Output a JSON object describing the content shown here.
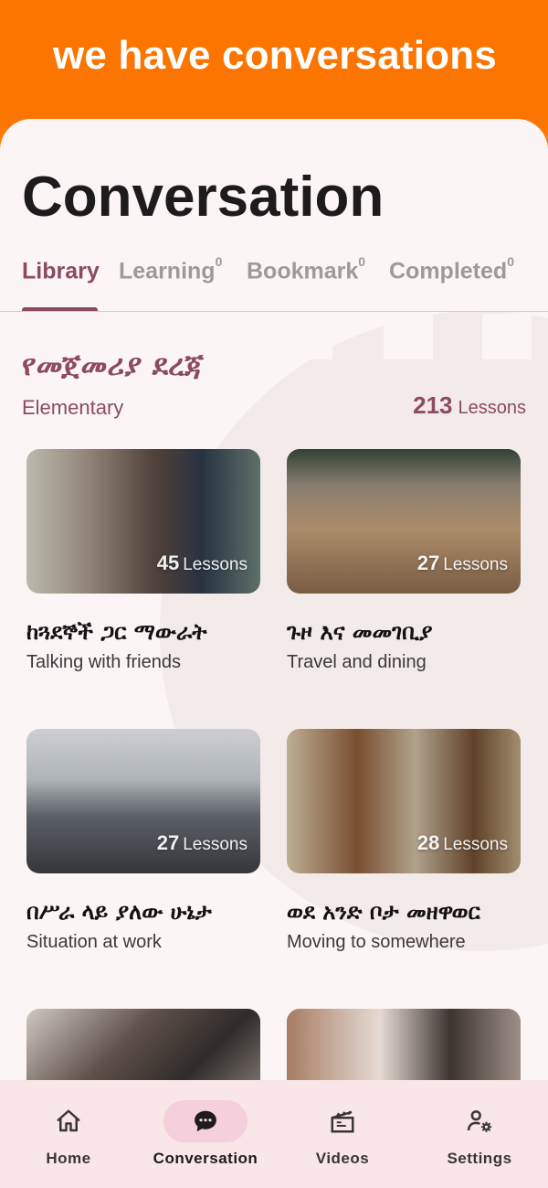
{
  "banner": {
    "text": "we have conversations"
  },
  "page": {
    "title": "Conversation"
  },
  "tabs": [
    {
      "label": "Library",
      "count": ""
    },
    {
      "label": "Learning",
      "count": "0"
    },
    {
      "label": "Bookmark",
      "count": "0"
    },
    {
      "label": "Completed",
      "count": "0"
    }
  ],
  "level": {
    "title": "የመጀመሪያ ደረጃ",
    "subtitle": "Elementary",
    "lessons_count": "213",
    "lessons_label": "Lessons"
  },
  "cards": [
    {
      "count": "45",
      "count_label": "Lessons",
      "title": "ከጓደኞች ጋር ማውራት",
      "subtitle": "Talking with friends"
    },
    {
      "count": "27",
      "count_label": "Lessons",
      "title": "ጉዞ እና መመገቢያ",
      "subtitle": "Travel and dining"
    },
    {
      "count": "27",
      "count_label": "Lessons",
      "title": "በሥራ ላይ ያለው ሁኔታ",
      "subtitle": "Situation at work"
    },
    {
      "count": "28",
      "count_label": "Lessons",
      "title": "ወደ አንድ ቦታ መዘዋወር",
      "subtitle": "Moving to somewhere"
    }
  ],
  "nav": [
    {
      "label": "Home",
      "icon": "home-icon"
    },
    {
      "label": "Conversation",
      "icon": "chat-bubble-icon"
    },
    {
      "label": "Videos",
      "icon": "clapperboard-icon"
    },
    {
      "label": "Settings",
      "icon": "user-settings-icon"
    }
  ],
  "colors": {
    "banner": "#fb7500",
    "accent": "#8c4a63",
    "background": "#fcf5f5",
    "nav_background": "#f8e6e8",
    "nav_active_pill": "#f6cfdc"
  }
}
